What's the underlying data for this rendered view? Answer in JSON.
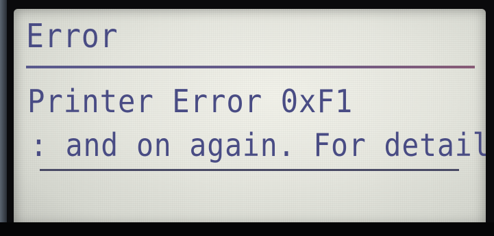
{
  "screen": {
    "title": "Error",
    "message_line_1": "Printer Error 0xF1",
    "message_line_2": ": and on again. For details"
  },
  "colors": {
    "lcd_background": "#e6e7df",
    "lcd_text": "#4a4d86",
    "divider": "#5a5b8e"
  }
}
